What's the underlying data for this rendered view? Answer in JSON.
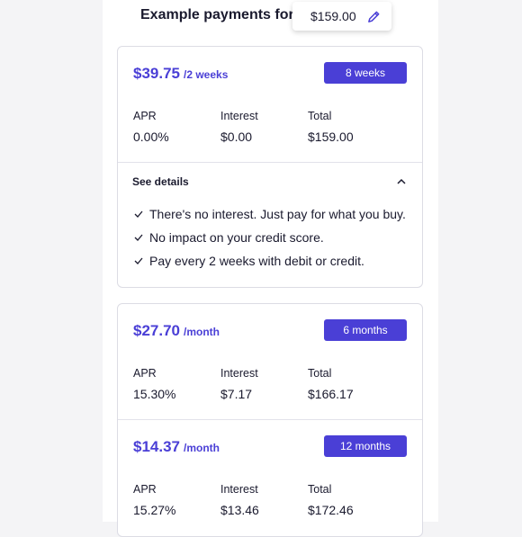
{
  "header": {
    "title": "Example payments for",
    "amount": "$159.00",
    "edit_icon": "pencil-icon"
  },
  "plans": [
    {
      "price": "$39.75",
      "period": "/2 weeks",
      "term": "8 weeks",
      "apr_label": "APR",
      "apr": "0.00%",
      "interest_label": "Interest",
      "interest": "$0.00",
      "total_label": "Total",
      "total": "$159.00"
    },
    {
      "price": "$27.70",
      "period": "/month",
      "term": "6 months",
      "apr_label": "APR",
      "apr": "15.30%",
      "interest_label": "Interest",
      "interest": "$7.17",
      "total_label": "Total",
      "total": "$166.17"
    },
    {
      "price": "$14.37",
      "period": "/month",
      "term": "12 months",
      "apr_label": "APR",
      "apr": "15.27%",
      "interest_label": "Interest",
      "interest": "$13.46",
      "total_label": "Total",
      "total": "$172.46"
    }
  ],
  "details": {
    "toggle_label": "See details",
    "expanded": true,
    "items": [
      "There's no interest. Just pay for what you buy.",
      "No impact on your credit score.",
      "Pay every 2 weeks with debit or credit."
    ]
  },
  "colors": {
    "accent": "#4a3fd6",
    "text": "#1a1a2e",
    "border": "#dcdce4",
    "background": "#f4f4f6"
  }
}
